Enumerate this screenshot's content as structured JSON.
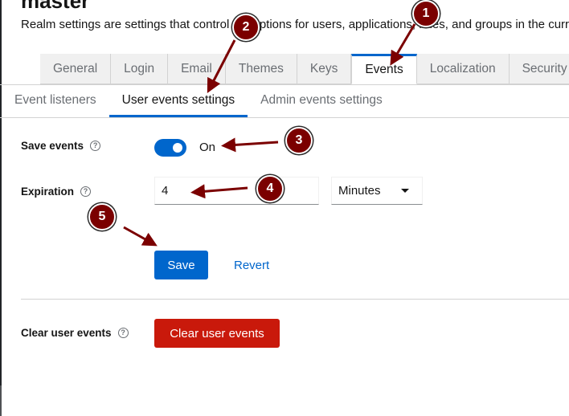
{
  "header": {
    "title": "master",
    "subtitle": "Realm settings are settings that control the options for users, applications, roles, and groups in the current realm."
  },
  "tabs": [
    {
      "label": "General",
      "active": false
    },
    {
      "label": "Login",
      "active": false
    },
    {
      "label": "Email",
      "active": false
    },
    {
      "label": "Themes",
      "active": false
    },
    {
      "label": "Keys",
      "active": false
    },
    {
      "label": "Events",
      "active": true
    },
    {
      "label": "Localization",
      "active": false
    },
    {
      "label": "Security",
      "active": false
    }
  ],
  "subtabs": [
    {
      "label": "Event listeners",
      "active": false
    },
    {
      "label": "User events settings",
      "active": true
    },
    {
      "label": "Admin events settings",
      "active": false
    }
  ],
  "form": {
    "save_events": {
      "label": "Save events",
      "help": "?",
      "state_text": "On",
      "enabled": true
    },
    "expiration": {
      "label": "Expiration",
      "help": "?",
      "value": "4",
      "unit": "Minutes"
    },
    "save_label": "Save",
    "revert_label": "Revert",
    "clear": {
      "label": "Clear user events",
      "help": "?",
      "button_label": "Clear user events"
    }
  },
  "callouts": [
    "1",
    "2",
    "3",
    "4",
    "5"
  ],
  "colors": {
    "primary": "#0066cc",
    "danger": "#c9190b",
    "callout": "#7b0000"
  }
}
